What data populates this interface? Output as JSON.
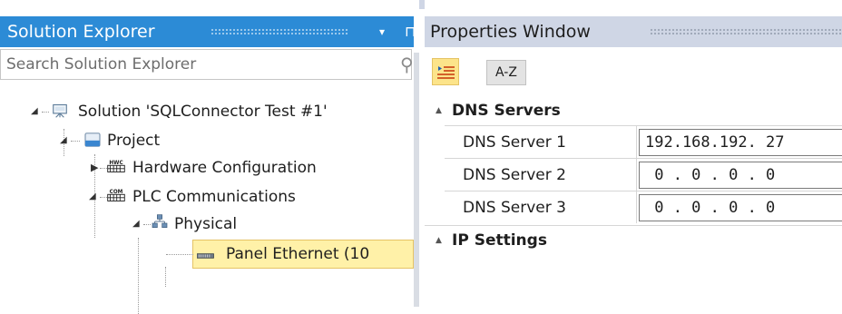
{
  "solution_explorer": {
    "title": "Solution Explorer",
    "dropdown_glyph": "▾",
    "pin_glyph": "⊓",
    "search_placeholder": "Search Solution Explorer",
    "tree": [
      {
        "label": "Solution 'SQLConnector Test #1'",
        "icon": "solution-icon",
        "expanded": true
      },
      {
        "label": "Project",
        "icon": "project-icon",
        "expanded": true
      },
      {
        "label": "Hardware Configuration",
        "icon": "hardware-config-icon",
        "expanded": false,
        "icon_text": "HWC"
      },
      {
        "label": "PLC Communications",
        "icon": "plc-communications-icon",
        "expanded": true,
        "icon_text": "COM"
      },
      {
        "label": "Physical",
        "icon": "network-icon",
        "expanded": true
      },
      {
        "label": "Panel Ethernet (10",
        "icon": "ethernet-port-icon",
        "selected": true
      }
    ]
  },
  "properties": {
    "title": "Properties Window",
    "toolbar": {
      "categorized_icon": "categorized-icon",
      "az_label": "A-Z"
    },
    "categories": [
      {
        "name": "DNS Servers",
        "rows": [
          {
            "name": "DNS Server 1",
            "value": "192.168.192. 27"
          },
          {
            "name": "DNS Server 2",
            "value": " 0 . 0 . 0 . 0"
          },
          {
            "name": "DNS Server 3",
            "value": " 0 . 0 . 0 . 0"
          }
        ]
      },
      {
        "name": "IP Settings",
        "rows": []
      }
    ]
  },
  "colors": {
    "se_title_bg": "#2c8bd6",
    "selection_bg": "#fff1a8",
    "selection_border": "#e5c365"
  }
}
